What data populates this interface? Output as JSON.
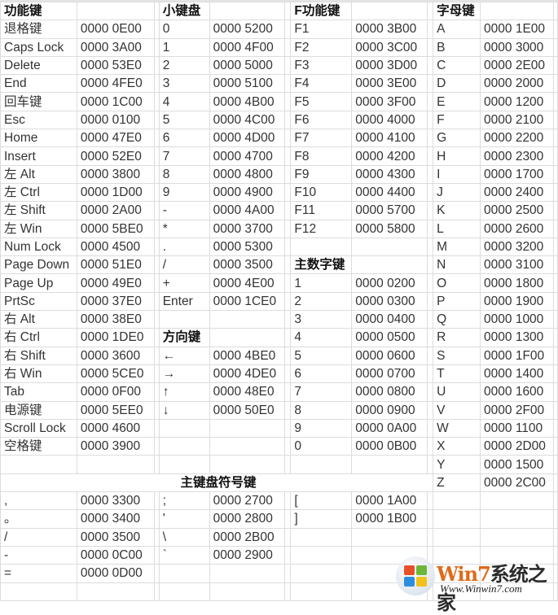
{
  "rows": [
    [
      "功能键",
      "",
      "小键盘",
      "",
      "F功能键",
      "",
      "字母键",
      ""
    ],
    [
      "退格键",
      "0000 0E00",
      "0",
      "0000 5200",
      "F1",
      "0000 3B00",
      "A",
      "0000 1E00"
    ],
    [
      "Caps Lock",
      "0000 3A00",
      "1",
      "0000 4F00",
      "F2",
      "0000 3C00",
      "B",
      "0000 3000"
    ],
    [
      "Delete",
      "0000 53E0",
      "2",
      "0000 5000",
      "F3",
      "0000 3D00",
      "C",
      "0000 2E00"
    ],
    [
      "End",
      "0000 4FE0",
      "3",
      "0000 5100",
      "F4",
      "0000 3E00",
      "D",
      "0000 2000"
    ],
    [
      "回车键",
      "0000 1C00",
      "4",
      "0000 4B00",
      "F5",
      "0000 3F00",
      "E",
      "0000 1200"
    ],
    [
      "Esc",
      "0000 0100",
      "5",
      "0000 4C00",
      "F6",
      "0000 4000",
      "F",
      "0000 2100"
    ],
    [
      "Home",
      "0000 47E0",
      "6",
      "0000 4D00",
      "F7",
      "0000 4100",
      "G",
      "0000 2200"
    ],
    [
      "Insert",
      "0000 52E0",
      "7",
      "0000 4700",
      "F8",
      "0000 4200",
      "H",
      "0000 2300"
    ],
    [
      "左 Alt",
      "0000 3800",
      "8",
      "0000 4800",
      "F9",
      "0000 4300",
      "I",
      "0000 1700"
    ],
    [
      "左 Ctrl",
      "0000 1D00",
      "9",
      "0000 4900",
      "F10",
      "0000 4400",
      "J",
      "0000 2400"
    ],
    [
      "左 Shift",
      "0000 2A00",
      "-",
      "0000 4A00",
      "F11",
      "0000 5700",
      "K",
      "0000 2500"
    ],
    [
      "左 Win",
      "0000 5BE0",
      "*",
      "0000 3700",
      "F12",
      "0000 5800",
      "L",
      "0000 2600"
    ],
    [
      "Num Lock",
      "0000 4500",
      ".",
      "0000 5300",
      "",
      "",
      "M",
      "0000 3200"
    ],
    [
      "Page Down",
      "0000 51E0",
      "/",
      "0000 3500",
      "主数字键",
      "",
      "N",
      "0000 3100"
    ],
    [
      "Page Up",
      "0000 49E0",
      "+",
      "0000 4E00",
      "1",
      "0000 0200",
      "O",
      "0000 1800"
    ],
    [
      "PrtSc",
      "0000 37E0",
      "Enter",
      "0000 1CE0",
      "2",
      "0000 0300",
      "P",
      "0000 1900"
    ],
    [
      "右 Alt",
      "0000 38E0",
      "",
      "",
      "3",
      "0000 0400",
      "Q",
      "0000 1000"
    ],
    [
      "右 Ctrl",
      "0000 1DE0",
      "方向键",
      "",
      "4",
      "0000 0500",
      "R",
      "0000 1300"
    ],
    [
      "右 Shift",
      "0000 3600",
      "←",
      "0000 4BE0",
      "5",
      "0000 0600",
      "S",
      "0000 1F00"
    ],
    [
      "右 Win",
      "0000 5CE0",
      "→",
      "0000 4DE0",
      "6",
      "0000 0700",
      "T",
      "0000 1400"
    ],
    [
      "Tab",
      "0000 0F00",
      "↑",
      "0000 48E0",
      "7",
      "0000 0800",
      "U",
      "0000 1600"
    ],
    [
      "电源键",
      "0000 5EE0",
      "↓",
      "0000 50E0",
      "8",
      "0000 0900",
      "V",
      "0000 2F00"
    ],
    [
      "Scroll Lock",
      "0000 4600",
      "",
      "",
      "9",
      "0000 0A00",
      "W",
      "0000 1100"
    ],
    [
      "空格键",
      "0000 3900",
      "",
      "",
      "0",
      "0000 0B00",
      "X",
      "0000 2D00"
    ],
    [
      "",
      "",
      "",
      "",
      "",
      "",
      "Y",
      "0000 1500"
    ],
    [
      "主键盘符号键",
      "",
      "",
      "",
      "",
      "",
      "Z",
      "0000 2C00"
    ],
    [
      ",",
      "0000 3300",
      ";",
      "0000 2700",
      "[",
      "0000 1A00",
      "",
      ""
    ],
    [
      "。",
      "0000 3400",
      "'",
      "0000 2800",
      "]",
      "0000 1B00",
      "",
      ""
    ],
    [
      "/",
      "0000 3500",
      "\\",
      "0000 2B00",
      "",
      "",
      "",
      ""
    ],
    [
      "-",
      "0000 0C00",
      "`",
      "0000 2900",
      "",
      "",
      "",
      ""
    ],
    [
      "=",
      "0000 0D00",
      "",
      "",
      "",
      "",
      "",
      ""
    ],
    [
      "",
      "",
      "",
      "",
      "",
      "",
      "",
      ""
    ]
  ],
  "bold_cells": [
    [
      0,
      0
    ],
    [
      0,
      2
    ],
    [
      0,
      4
    ],
    [
      0,
      6
    ],
    [
      14,
      4
    ],
    [
      18,
      2
    ]
  ],
  "merged_row": 26,
  "watermark": {
    "title_a": "Win7",
    "title_b": "系统之家",
    "url": "Www.Winwin7.com",
    "colors": [
      "#e8502a",
      "#6cb63a",
      "#2d8ee0",
      "#f2c21a"
    ]
  }
}
